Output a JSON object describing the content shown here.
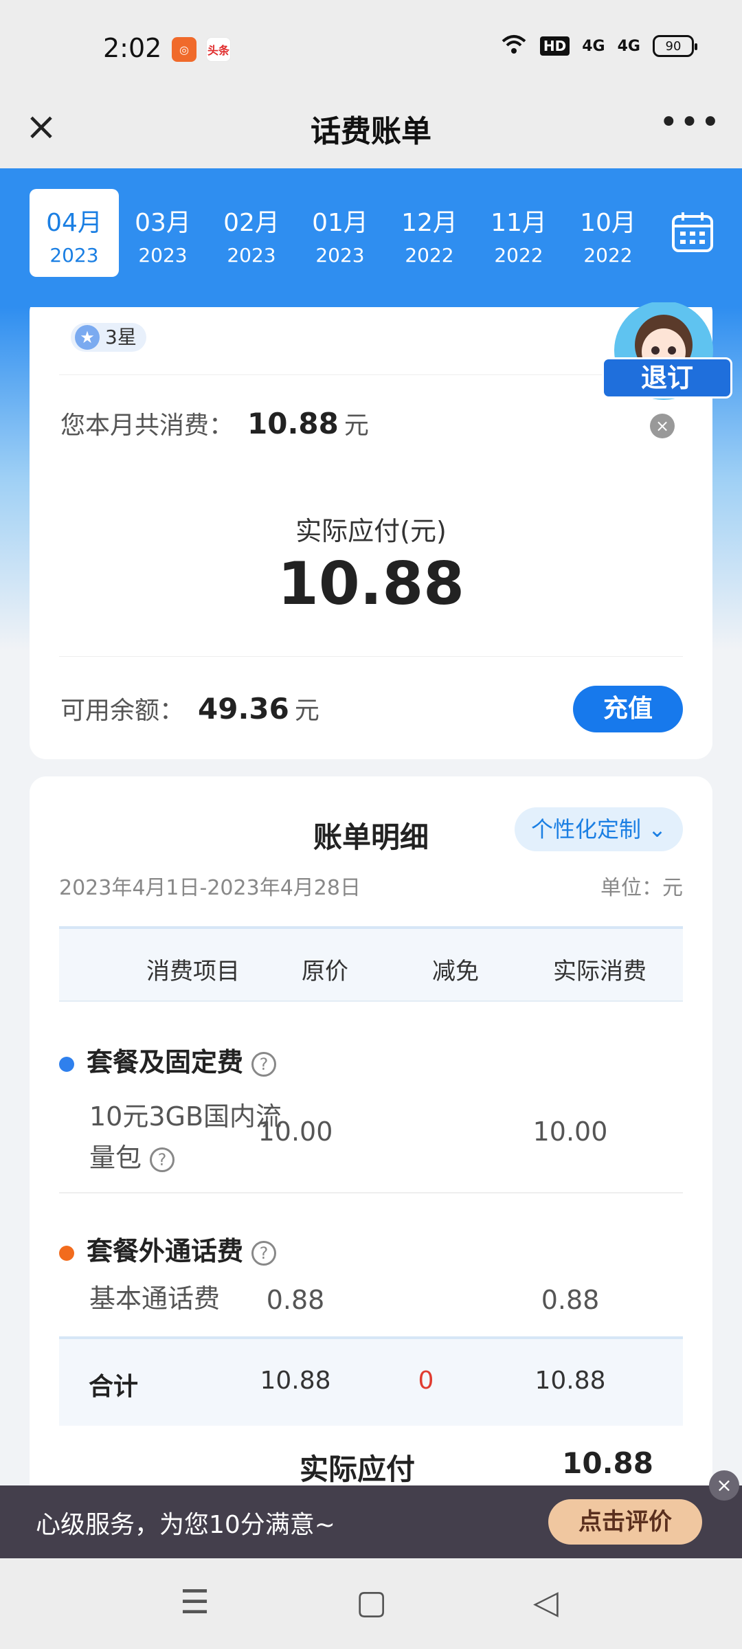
{
  "status_bar": {
    "time": "2:02",
    "app_badge_1": "◎",
    "app_badge_2": "头条",
    "hd": "HD",
    "signal_1": "4G",
    "signal_2": "4G",
    "battery": "90"
  },
  "nav": {
    "title": "话费账单",
    "close": "×",
    "more": "•••"
  },
  "months": [
    {
      "month": "04月",
      "year": "2023"
    },
    {
      "month": "03月",
      "year": "2023"
    },
    {
      "month": "02月",
      "year": "2023"
    },
    {
      "month": "01月",
      "year": "2023"
    },
    {
      "month": "12月",
      "year": "2022"
    },
    {
      "month": "11月",
      "year": "2022"
    },
    {
      "month": "10月",
      "year": "2022"
    }
  ],
  "summary": {
    "star_level": "3星",
    "star_icon": "★",
    "consume_label": "您本月共消费：",
    "consume_value": "10.88",
    "consume_unit": "元",
    "pay_label": "实际应付(元)",
    "pay_amount": "10.88",
    "balance_label": "可用余额：",
    "balance_value": "49.36",
    "balance_unit": "元",
    "recharge": "充值"
  },
  "mascot": {
    "unsubscribe": "退订"
  },
  "detail": {
    "title": "账单明细",
    "custom_button": "个性化定制 ⌄",
    "date_range": "2023年4月1日-2023年4月28日",
    "unit": "单位：元",
    "headers": [
      "消费项目",
      "原价",
      "减免",
      "实际消费"
    ],
    "groups": [
      {
        "title": "套餐及固定费",
        "item_line1": "10元3GB国内流",
        "item_line2": "量包",
        "original": "10.00",
        "actual": "10.00"
      },
      {
        "title": "套餐外通话费",
        "item_line1": "基本通话费",
        "original": "0.88",
        "actual": "0.88"
      }
    ],
    "total": {
      "label": "合计",
      "original": "10.88",
      "discount": "0",
      "actual": "10.88"
    },
    "pay_row": {
      "label": "实际应付",
      "value": "10.88"
    }
  },
  "banner": {
    "text": "心级服务，为您10分满意~",
    "button": "点击评价",
    "close": "×"
  },
  "colors": {
    "primary": "#1779ec",
    "header_blue": "#2f8ef0",
    "discount_red": "#e03c31",
    "dot_blue": "#2f80ed",
    "dot_orange": "#f26b1d"
  }
}
